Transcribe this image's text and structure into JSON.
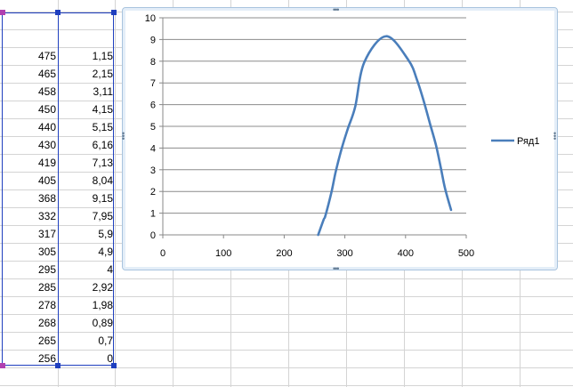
{
  "sheet": {
    "column_a": [
      "475",
      "465",
      "458",
      "450",
      "440",
      "430",
      "419",
      "405",
      "368",
      "332",
      "317",
      "305",
      "295",
      "285",
      "278",
      "268",
      "265",
      "256"
    ],
    "column_b": [
      "1,15",
      "2,15",
      "3,11",
      "4,15",
      "5,15",
      "6,16",
      "7,13",
      "8,04",
      "9,15",
      "7,95",
      "5,9",
      "4,9",
      "4",
      "2,92",
      "1,98",
      "0,89",
      "0,7",
      "0"
    ]
  },
  "chart_data": {
    "type": "line",
    "series": [
      {
        "name": "Ряд1",
        "color": "#4a7ebb",
        "x": [
          475,
          465,
          458,
          450,
          440,
          430,
          419,
          405,
          368,
          332,
          317,
          305,
          295,
          285,
          278,
          268,
          265,
          256
        ],
        "y": [
          1.15,
          2.15,
          3.11,
          4.15,
          5.15,
          6.16,
          7.13,
          8.04,
          9.15,
          7.95,
          5.9,
          4.9,
          4,
          2.92,
          1.98,
          0.89,
          0.7,
          0
        ]
      }
    ],
    "xlim": [
      0,
      500
    ],
    "ylim": [
      0,
      10
    ],
    "x_ticks": [
      "0",
      "100",
      "200",
      "300",
      "400",
      "500"
    ],
    "y_ticks": [
      "0",
      "1",
      "2",
      "3",
      "4",
      "5",
      "6",
      "7",
      "8",
      "9",
      "10"
    ],
    "grid": "horizontal",
    "legend_position": "right"
  }
}
